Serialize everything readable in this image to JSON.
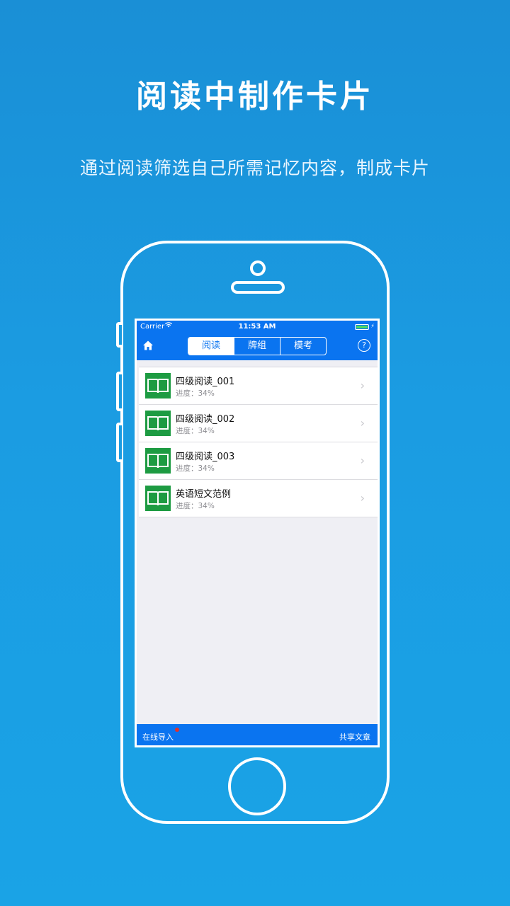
{
  "promo": {
    "headline": "阅读中制作卡片",
    "subline": "通过阅读筛选自己所需记忆内容，制成卡片"
  },
  "status_bar": {
    "carrier": "Carrier",
    "time": "11:53 AM"
  },
  "nav": {
    "tabs": [
      {
        "label": "阅读",
        "active": true
      },
      {
        "label": "牌组",
        "active": false
      },
      {
        "label": "模考",
        "active": false
      }
    ],
    "help_label": "?"
  },
  "list": {
    "items": [
      {
        "title": "四级阅读_001",
        "progress": "进度：34%"
      },
      {
        "title": "四级阅读_002",
        "progress": "进度：34%"
      },
      {
        "title": "四级阅读_003",
        "progress": "进度：34%"
      },
      {
        "title": "英语短文范例",
        "progress": "进度：34%"
      }
    ]
  },
  "bottom_bar": {
    "import_label": "在线导入",
    "share_label": "共享文章"
  },
  "colors": {
    "nav_blue": "#0a74f0",
    "book_green": "#1d9b42",
    "badge_red": "#e0302c"
  }
}
